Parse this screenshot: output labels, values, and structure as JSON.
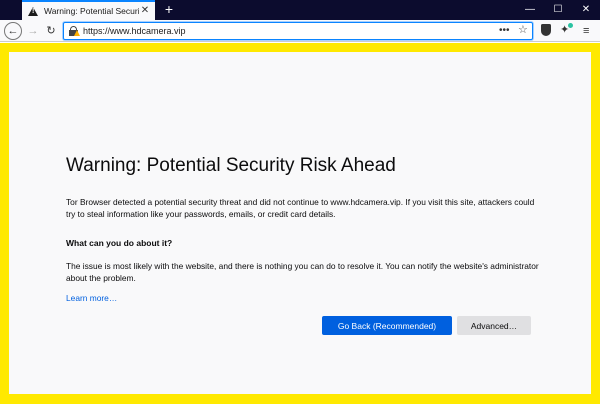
{
  "tab": {
    "title": "Warning: Potential Security Risk Ahead",
    "close_glyph": "✕"
  },
  "toolbar": {
    "new_tab_glyph": "+",
    "back_glyph": "←",
    "forward_glyph": "→",
    "reload_glyph": "↻",
    "url": "https://www.hdcamera.vip",
    "page_actions_glyph": "•••",
    "bookmark_glyph": "☆",
    "menu_glyph": "≡",
    "wand_glyph": "✦"
  },
  "window": {
    "minimize_glyph": "—",
    "maximize_glyph": "☐",
    "close_glyph": "✕"
  },
  "page": {
    "heading": "Warning: Potential Security Risk Ahead",
    "intro": "Tor Browser detected a potential security threat and did not continue to www.hdcamera.vip. If you visit this site, attackers could try to steal information like your passwords, emails, or credit card details.",
    "subheading": "What can you do about it?",
    "explanation": "The issue is most likely with the website, and there is nothing you can do to resolve it. You can notify the website's administrator about the problem.",
    "learn_more": "Learn more…",
    "go_back_label": "Go Back (Recommended)",
    "advanced_label": "Advanced…"
  },
  "colors": {
    "warning_border": "#ffe900",
    "primary_button": "#0060df",
    "link": "#0060df",
    "tabstrip": "#0c0c2e"
  }
}
